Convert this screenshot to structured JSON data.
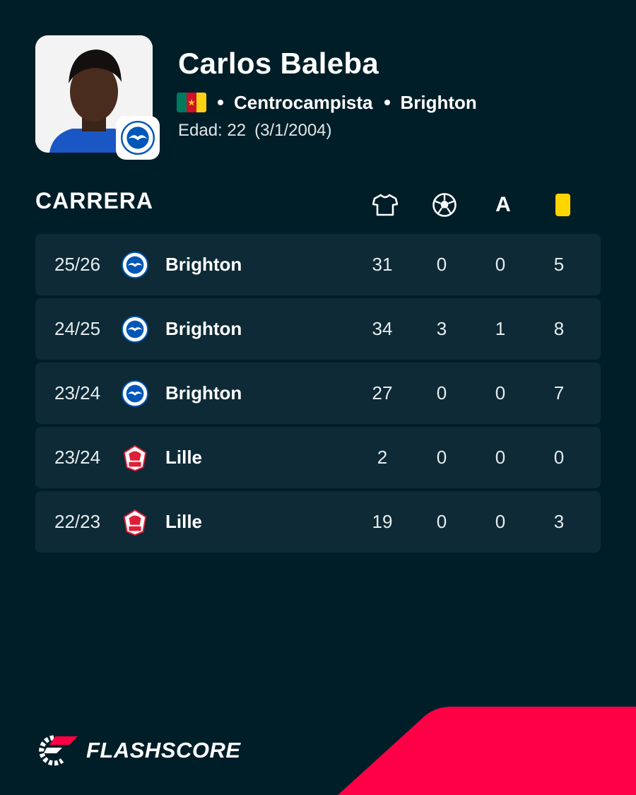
{
  "player": {
    "name": "Carlos Baleba",
    "nationality_flag": "cameroon-flag",
    "position": "Centrocampista",
    "team": "Brighton",
    "age_text": "Edad: 22",
    "birthdate_text": "(3/1/2004)"
  },
  "career": {
    "title": "CARRERA",
    "columns": [
      "appearances-shirt-icon",
      "goals-ball-icon",
      "assists-A",
      "yellow-cards-icon"
    ],
    "assist_column_label": "A",
    "rows": [
      {
        "season": "25/26",
        "team": "Brighton",
        "crest": "brighton-crest-icon",
        "appearances": "31",
        "goals": "0",
        "assists": "0",
        "yellow_cards": "5"
      },
      {
        "season": "24/25",
        "team": "Brighton",
        "crest": "brighton-crest-icon",
        "appearances": "34",
        "goals": "3",
        "assists": "1",
        "yellow_cards": "8"
      },
      {
        "season": "23/24",
        "team": "Brighton",
        "crest": "brighton-crest-icon",
        "appearances": "27",
        "goals": "0",
        "assists": "0",
        "yellow_cards": "7"
      },
      {
        "season": "23/24",
        "team": "Lille",
        "crest": "lille-crest-icon",
        "appearances": "2",
        "goals": "0",
        "assists": "0",
        "yellow_cards": "0"
      },
      {
        "season": "22/23",
        "team": "Lille",
        "crest": "lille-crest-icon",
        "appearances": "19",
        "goals": "0",
        "assists": "0",
        "yellow_cards": "3"
      }
    ]
  },
  "brand": {
    "name": "FLASHSCORE",
    "accent": "#ff0046"
  },
  "colors": {
    "background": "#001e28",
    "row_background": "#0d2a36",
    "yellow_card": "#ffd500",
    "brighton_blue": "#0057b8",
    "lille_red": "#e01e37"
  }
}
